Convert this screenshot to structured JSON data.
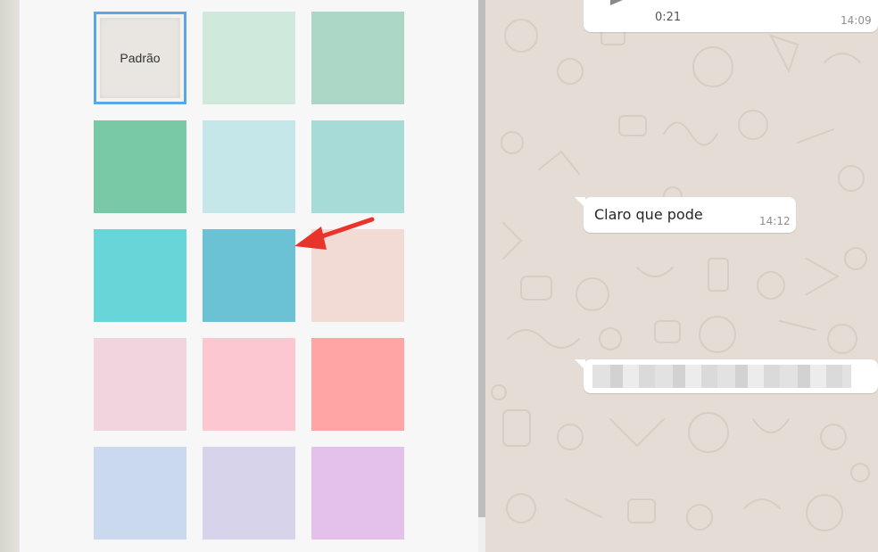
{
  "wallpaper_picker": {
    "default_label": "Padrão",
    "swatches": [
      {
        "color": "#e9e6e1",
        "selected": true,
        "default": true
      },
      {
        "color": "#cfe9dc"
      },
      {
        "color": "#acd7c7"
      },
      {
        "color": "#79c8a6"
      },
      {
        "color": "#c6e7e9"
      },
      {
        "color": "#a7dbd7"
      },
      {
        "color": "#68d5d9"
      },
      {
        "color": "#6cc2d5",
        "highlighted": true
      },
      {
        "color": "#f2dbd5"
      },
      {
        "color": "#f2d4de"
      },
      {
        "color": "#fcc7d0"
      },
      {
        "color": "#ffa5a5"
      },
      {
        "color": "#cbd9ee"
      },
      {
        "color": "#d6d3ea"
      },
      {
        "color": "#e3c1eb"
      }
    ]
  },
  "chat": {
    "voice_message": {
      "duration": "0:21",
      "time": "14:09"
    },
    "text_message": {
      "text": "Claro que pode",
      "time": "14:12"
    },
    "redacted_message": {
      "blurred": true
    }
  },
  "colors": {
    "selection_border": "#5aa6e6",
    "annotation_arrow": "#e8342b",
    "chat_wallpaper": "#e5ddd5"
  }
}
